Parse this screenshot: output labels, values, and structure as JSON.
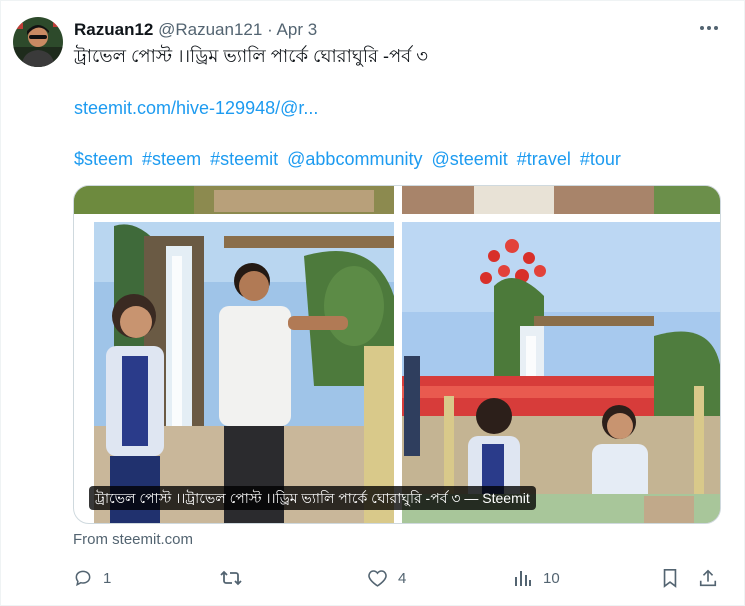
{
  "post": {
    "display_name": "Razuan12",
    "handle": "@Razuan121",
    "separator": "·",
    "date": "Apr 3",
    "title": "ট্রাভেল পোস্ট ।।ড্রিম ভ্যালি পার্কে ঘোরাঘুরি -পর্ব ৩",
    "link": "steemit.com/hive-129948/@r...",
    "tags": [
      "$steem",
      "#steem",
      "#steemit",
      "@abbcommunity",
      "@steemit",
      "#travel",
      "#tour"
    ]
  },
  "card": {
    "caption": "ট্রাভেল পোস্ট ।।ট্রাভেল পোস্ট ।।ড্রিম ভ্যালি পার্কে ঘোরাঘুরি -পর্ব ৩ — Steemit",
    "source": "From steemit.com"
  },
  "actions": {
    "reply_count": "1",
    "retweet_count": "",
    "like_count": "4",
    "view_count": "10"
  },
  "icons": {
    "more": "more-icon",
    "reply": "reply-icon",
    "retweet": "retweet-icon",
    "like": "heart-icon",
    "views": "views-icon",
    "bookmark": "bookmark-icon",
    "share": "share-icon"
  },
  "colors": {
    "link": "#1d9bf0",
    "muted": "#536471",
    "text": "#0f1419",
    "border": "#cfd9de"
  }
}
